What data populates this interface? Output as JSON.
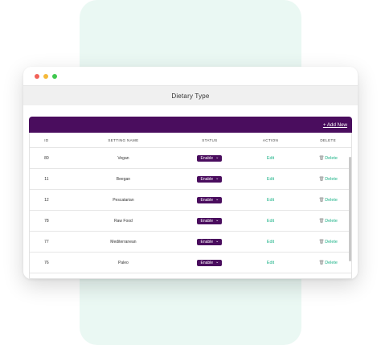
{
  "window": {
    "controls": [
      {
        "name": "close",
        "color": "#f26158"
      },
      {
        "name": "minimize",
        "color": "#f5b93a"
      },
      {
        "name": "maximize",
        "color": "#3fc84e"
      }
    ]
  },
  "page": {
    "title": "Dietary Type",
    "add_new_label": "+ Add New"
  },
  "colors": {
    "header_purple": "#4a0d5e",
    "link_green": "#1bb287",
    "background_mint": "#eaf8f3"
  },
  "table": {
    "columns": [
      "ID",
      "SETTING NAME",
      "STATUS",
      "ACTION",
      "DELETE"
    ],
    "rows": [
      {
        "id": "80",
        "name": "Vegan",
        "status": "Enable",
        "action": "Edit",
        "delete": "Delete"
      },
      {
        "id": "11",
        "name": "Beegan",
        "status": "Enable",
        "action": "Edit",
        "delete": "Delete"
      },
      {
        "id": "12",
        "name": "Pescatarian",
        "status": "Enable",
        "action": "Edit",
        "delete": "Delete"
      },
      {
        "id": "78",
        "name": "Raw Food",
        "status": "Enable",
        "action": "Edit",
        "delete": "Delete"
      },
      {
        "id": "77",
        "name": "Mediterranean",
        "status": "Enable",
        "action": "Edit",
        "delete": "Delete"
      },
      {
        "id": "76",
        "name": "Paleo",
        "status": "Enable",
        "action": "Edit",
        "delete": "Delete"
      }
    ]
  },
  "icons": {
    "status_dropdown": "chevron-down-icon",
    "delete": "trash-icon"
  }
}
